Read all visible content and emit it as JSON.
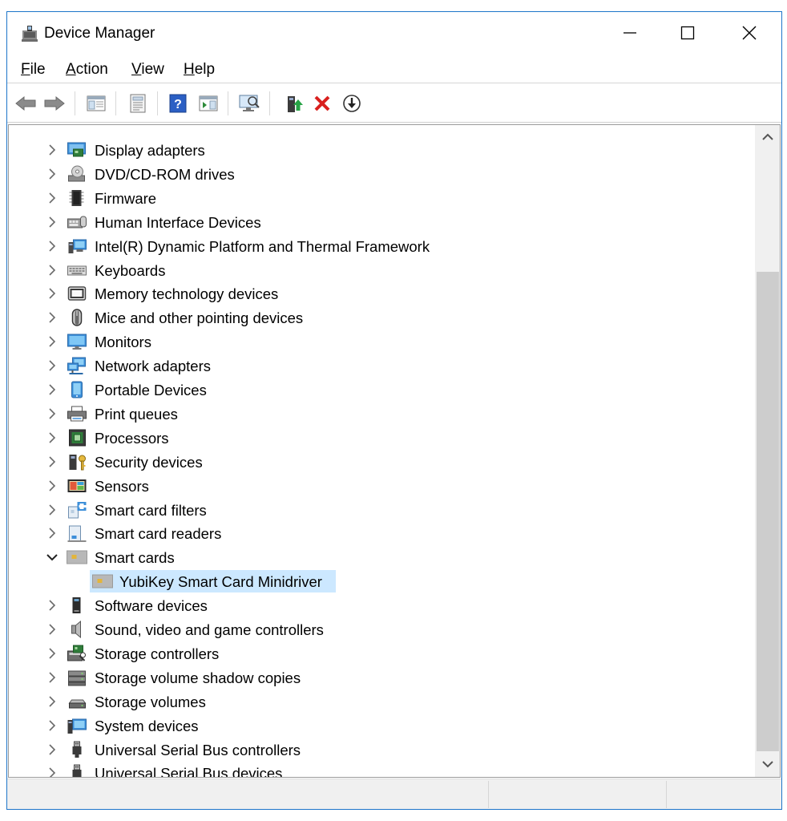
{
  "window": {
    "title": "Device Manager",
    "controls": {
      "minimize": "minimize",
      "maximize": "maximize",
      "close": "close"
    }
  },
  "menu": {
    "file": {
      "accel": "F",
      "rest": "ile"
    },
    "action": {
      "accel": "A",
      "rest": "ction"
    },
    "view": {
      "accel": "V",
      "rest": "iew"
    },
    "help": {
      "accel": "H",
      "rest": "elp"
    }
  },
  "toolbar": {
    "icons": [
      "back-icon",
      "forward-icon",
      "show-hide-console-tree-icon",
      "properties-icon",
      "help-icon",
      "action-pane-icon",
      "scan-hardware-icon",
      "update-driver-icon",
      "uninstall-icon",
      "disable-device-icon"
    ]
  },
  "tree": {
    "items": [
      {
        "label": "Display adapters",
        "icon": "display-adapter-icon",
        "expanded": false
      },
      {
        "label": "DVD/CD-ROM drives",
        "icon": "dvd-drive-icon",
        "expanded": false
      },
      {
        "label": "Firmware",
        "icon": "firmware-chip-icon",
        "expanded": false
      },
      {
        "label": "Human Interface Devices",
        "icon": "hid-icon",
        "expanded": false
      },
      {
        "label": "Intel(R) Dynamic Platform and Thermal Framework",
        "icon": "thermal-framework-icon",
        "expanded": false
      },
      {
        "label": "Keyboards",
        "icon": "keyboard-icon",
        "expanded": false
      },
      {
        "label": "Memory technology devices",
        "icon": "memory-device-icon",
        "expanded": false
      },
      {
        "label": "Mice and other pointing devices",
        "icon": "mouse-icon",
        "expanded": false
      },
      {
        "label": "Monitors",
        "icon": "monitor-icon",
        "expanded": false
      },
      {
        "label": "Network adapters",
        "icon": "network-adapter-icon",
        "expanded": false
      },
      {
        "label": "Portable Devices",
        "icon": "portable-device-icon",
        "expanded": false
      },
      {
        "label": "Print queues",
        "icon": "printer-icon",
        "expanded": false
      },
      {
        "label": "Processors",
        "icon": "processor-icon",
        "expanded": false
      },
      {
        "label": "Security devices",
        "icon": "security-device-icon",
        "expanded": false
      },
      {
        "label": "Sensors",
        "icon": "sensor-icon",
        "expanded": false
      },
      {
        "label": "Smart card filters",
        "icon": "smart-card-filter-icon",
        "expanded": false
      },
      {
        "label": "Smart card readers",
        "icon": "smart-card-reader-icon",
        "expanded": false
      },
      {
        "label": "Smart cards",
        "icon": "smart-card-icon",
        "expanded": true,
        "children": [
          {
            "label": "YubiKey Smart Card Minidriver",
            "icon": "smart-card-icon",
            "selected": true
          }
        ]
      },
      {
        "label": "Software devices",
        "icon": "software-device-icon",
        "expanded": false
      },
      {
        "label": "Sound, video and game controllers",
        "icon": "speaker-icon",
        "expanded": false
      },
      {
        "label": "Storage controllers",
        "icon": "storage-controller-icon",
        "expanded": false
      },
      {
        "label": "Storage volume shadow copies",
        "icon": "shadow-copy-icon",
        "expanded": false
      },
      {
        "label": "Storage volumes",
        "icon": "storage-volume-icon",
        "expanded": false
      },
      {
        "label": "System devices",
        "icon": "system-device-icon",
        "expanded": false
      },
      {
        "label": "Universal Serial Bus controllers",
        "icon": "usb-icon",
        "expanded": false
      },
      {
        "label": "Universal Serial Bus devices",
        "icon": "usb-icon",
        "expanded": false
      }
    ]
  },
  "colors": {
    "window_border": "#1d75c9",
    "selection": "#cce8ff",
    "scroll_track": "#f0f0f0",
    "scroll_thumb": "#cdcdcd",
    "uninstall_red": "#d9201e",
    "help_blue": "#2b5fc4",
    "update_green": "#27a345"
  }
}
